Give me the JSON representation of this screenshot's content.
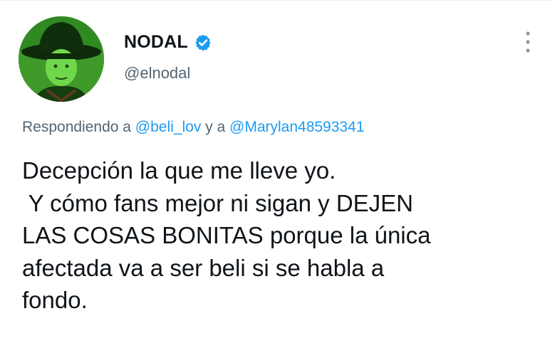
{
  "user": {
    "display_name": "NODAL",
    "handle": "@elnodal",
    "verified": true
  },
  "icons": {
    "verified": "verified-badge-icon",
    "more": "more-vertical-icon"
  },
  "reply": {
    "prefix": "Respondiendo a ",
    "mention1": "@beli_lov",
    "connector": " y a ",
    "mention2": "@Marylan48593341"
  },
  "tweet": {
    "lines": [
      "Decepción la que me lleve yo.",
      " Y cómo fans mejor ni sigan y DEJEN",
      "LAS COSAS BONITAS porque la única",
      "afectada va a ser beli si se habla a",
      "fondo."
    ]
  },
  "colors": {
    "text": "#0f1419",
    "secondary": "#536471",
    "accent": "#1d9bf0",
    "avatar_green": "#2e7d1f"
  }
}
